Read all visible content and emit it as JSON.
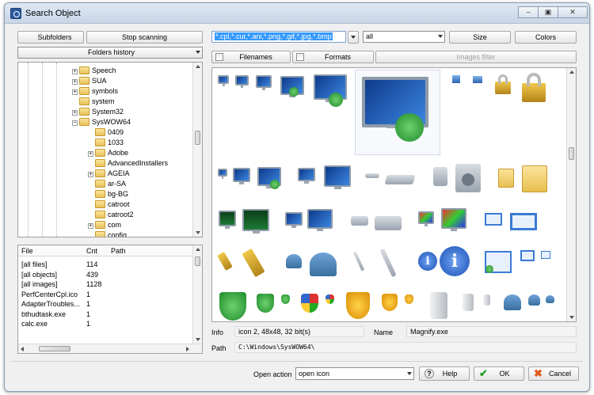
{
  "window": {
    "title": "Search Object",
    "controls": {
      "minimize": "–",
      "maximize": "▣",
      "close": "✕"
    }
  },
  "left": {
    "subfolders_label": "Subfolders",
    "stop_label": "Stop scanning",
    "history_label": "Folders history",
    "tree": [
      {
        "label": "Speech",
        "expand": "+",
        "indent": 0
      },
      {
        "label": "SUA",
        "expand": "+",
        "indent": 0
      },
      {
        "label": "symbols",
        "expand": "+",
        "indent": 0
      },
      {
        "label": "system",
        "expand": "",
        "indent": 0
      },
      {
        "label": "System32",
        "expand": "+",
        "indent": 0
      },
      {
        "label": "SysWOW64",
        "expand": "−",
        "indent": 0
      },
      {
        "label": "0409",
        "expand": "",
        "indent": 1
      },
      {
        "label": "1033",
        "expand": "",
        "indent": 1
      },
      {
        "label": "Adobe",
        "expand": "+",
        "indent": 1
      },
      {
        "label": "AdvancedInstallers",
        "expand": "",
        "indent": 1
      },
      {
        "label": "AGEIA",
        "expand": "+",
        "indent": 1
      },
      {
        "label": "ar-SA",
        "expand": "",
        "indent": 1
      },
      {
        "label": "bg-BG",
        "expand": "",
        "indent": 1
      },
      {
        "label": "catroot",
        "expand": "",
        "indent": 1
      },
      {
        "label": "catroot2",
        "expand": "",
        "indent": 1
      },
      {
        "label": "com",
        "expand": "+",
        "indent": 1
      },
      {
        "label": "config",
        "expand": "",
        "indent": 1
      }
    ],
    "list": {
      "headers": [
        "File",
        "Cnt",
        "Path"
      ],
      "rows": [
        [
          "[all files]",
          "114",
          ""
        ],
        [
          "[all objects]",
          "439",
          ""
        ],
        [
          "[all images]",
          "1128",
          ""
        ],
        [
          "PerfCenterCpl.ico",
          "1",
          ""
        ],
        [
          "AdapterTroubles...",
          "1",
          ""
        ],
        [
          "bthudtask.exe",
          "1",
          ""
        ],
        [
          "calc.exe",
          "1",
          ""
        ]
      ]
    }
  },
  "right": {
    "mask": "*.cpl,*.cur,*.ani,*.png,*.gif,*.jpg,*.bmp",
    "type_select": "all",
    "size_label": "Size",
    "colors_label": "Colors",
    "filenames_label": "Filenames",
    "formats_label": "Formats",
    "images_filter_label": "Images filter"
  },
  "info": {
    "info_label": "Info",
    "info_value": "icon 2, 48x48, 32 bit(s)",
    "name_label": "Name",
    "name_value": "Magnify.exe",
    "path_label": "Path",
    "path_value": "C:\\Windows\\SysWOW64\\"
  },
  "bottom": {
    "open_action_label": "Open action",
    "open_action_value": "open icon",
    "help_label": "Help",
    "ok_label": "OK",
    "cancel_label": "Cancel"
  },
  "colors": {
    "selection": "#3399ff",
    "accent": "#2b5aa0"
  }
}
